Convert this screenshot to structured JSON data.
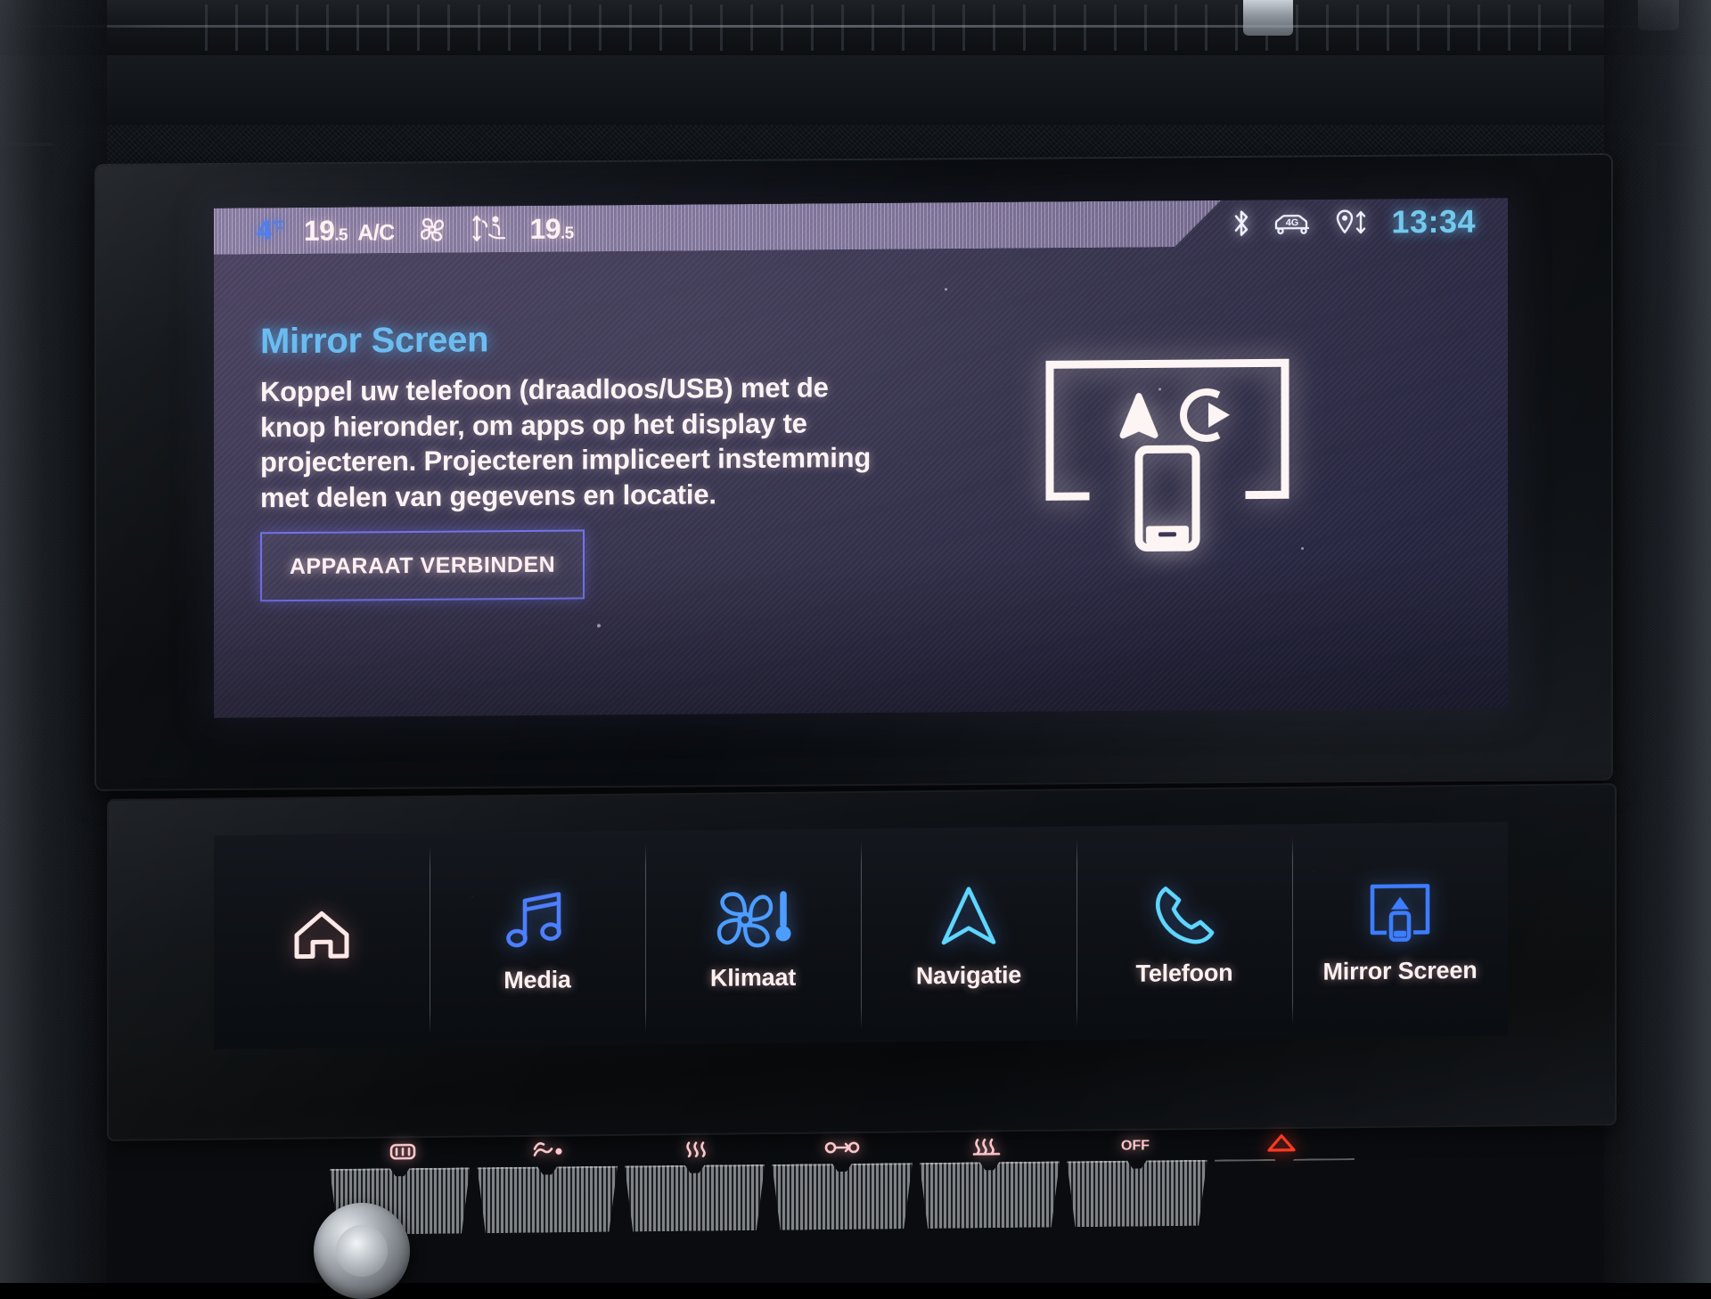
{
  "device": {
    "kind": "car-infotainment-touchscreen",
    "ui_language": "nl"
  },
  "status_bar": {
    "outside_temp": "4",
    "outside_temp_unit": "°C",
    "driver_temp_value": "19",
    "driver_temp_decimal": ".5",
    "ac_label": "A/C",
    "fan_icon": "fan-icon",
    "airflow_icon": "seat-airflow-icon",
    "passenger_temp_value": "19",
    "passenger_temp_decimal": ".5",
    "bluetooth_icon": "bluetooth-icon",
    "network_icon": "4g-connected-car-icon",
    "network_label": "4G",
    "location_icon": "location-sharing-icon",
    "time": "13:34"
  },
  "main": {
    "title": "Mirror Screen",
    "body": "Koppel uw telefoon (draadloos/USB) met de knop hieronder, om apps op het display te projecteren. Projecteren impliceert instemming met delen van gegevens en locatie.",
    "connect_button_label": "APPARAAT VERBINDEN",
    "illustration_icon": "screen-mirroring-illustration"
  },
  "nav_bar": {
    "items": [
      {
        "label": "",
        "icon": "home-icon",
        "active": false
      },
      {
        "label": "Media",
        "icon": "music-note-icon",
        "active": false
      },
      {
        "label": "Klimaat",
        "icon": "fan-thermometer-icon",
        "active": false
      },
      {
        "label": "Navigatie",
        "icon": "navigation-arrow-icon",
        "active": false
      },
      {
        "label": "Telefoon",
        "icon": "phone-handset-icon",
        "active": false
      },
      {
        "label": "Mirror Screen",
        "icon": "screen-cast-icon",
        "active": true
      }
    ]
  },
  "physical_switches": [
    {
      "icon": "rear-defrost-icon"
    },
    {
      "icon": "airflow-face-icon"
    },
    {
      "icon": "windshield-defrost-icon"
    },
    {
      "icon": "recirculation-icon"
    },
    {
      "icon": "airflow-feet-icon"
    },
    {
      "icon": "off-icon",
      "label": "OFF"
    },
    {
      "icon": "hazard-triangle-icon",
      "hazard": true
    }
  ],
  "colors": {
    "accent_blue": "#67b9ef",
    "button_border": "#6f6fe8",
    "time_blue": "#74c8ec",
    "outside_temp_blue": "#4f7ff0",
    "text_white": "#fbf3f4",
    "hazard_red": "#e23a22",
    "status_band": "#a898c4"
  }
}
